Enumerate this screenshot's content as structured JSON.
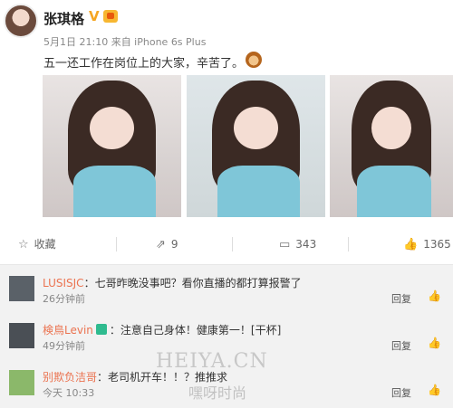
{
  "post": {
    "author": "张琪格",
    "verified_mark": "V",
    "meta": "5月1日 21:10 来自 iPhone 6s Plus",
    "text": "五一还工作在岗位上的大家，辛苦了。"
  },
  "actions": {
    "favorite_label": "收藏",
    "forward_count": "9",
    "comment_count": "343",
    "like_count": "1365",
    "icons": [
      "star-icon",
      "share-icon",
      "comment-icon",
      "thumbs-up-icon"
    ]
  },
  "comments": [
    {
      "user": "LUSISJC",
      "text": "：七哥昨晚没事吧？看你直播的都打算报警了",
      "time": "26分钟前",
      "reply": "回复"
    },
    {
      "user": "検鳥Levin",
      "text": "：注意自己身体！健康第一！[干杯]",
      "time": "49分钟前",
      "reply": "回复"
    },
    {
      "user": "别欺负洁哥",
      "text": "：老司机开车！！？推推求",
      "time": "今天 10:33",
      "reply": "回复"
    }
  ],
  "watermark": {
    "latin": "HEIYA.CN",
    "cn": "嘿呀时尚"
  },
  "colors": {
    "username": "#eb7350",
    "comment_bg": "#f2f2f2",
    "vip": "#2fbb8f"
  }
}
